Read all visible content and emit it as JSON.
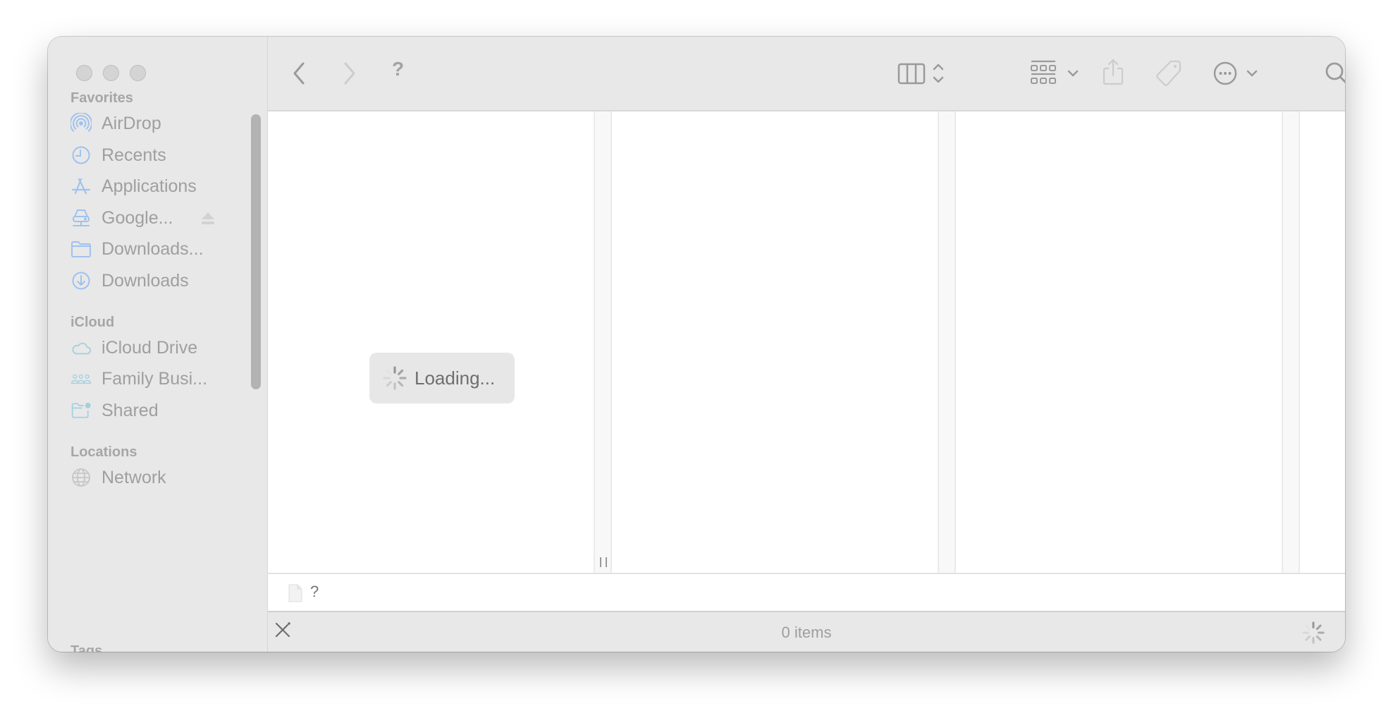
{
  "window": {
    "traffic_lights": [
      "close",
      "minimize",
      "zoom"
    ]
  },
  "sidebar": {
    "sections": [
      {
        "title": "Favorites",
        "items": [
          {
            "label": "AirDrop",
            "icon": "airdrop-icon"
          },
          {
            "label": "Recents",
            "icon": "clock-icon"
          },
          {
            "label": "Applications",
            "icon": "applications-icon"
          },
          {
            "label": "Google...",
            "icon": "network-drive-icon",
            "eject": true
          },
          {
            "label": "Downloads...",
            "icon": "folder-icon"
          },
          {
            "label": "Downloads",
            "icon": "download-icon"
          }
        ]
      },
      {
        "title": "iCloud",
        "items": [
          {
            "label": "iCloud Drive",
            "icon": "cloud-icon"
          },
          {
            "label": "Family Busi...",
            "icon": "people-icon"
          },
          {
            "label": "Shared",
            "icon": "shared-folder-icon"
          }
        ]
      },
      {
        "title": "Locations",
        "items": [
          {
            "label": "Network",
            "icon": "globe-icon"
          }
        ]
      },
      {
        "title": "Tags",
        "items": []
      }
    ]
  },
  "toolbar": {
    "title": "?",
    "back_label": "Back",
    "forward_label": "Forward",
    "view_mode": "columns",
    "group_label": "Group",
    "share_label": "Share",
    "tags_label": "Tags",
    "more_label": "More",
    "search_label": "Search"
  },
  "browser": {
    "loading_text": "Loading..."
  },
  "pathbar": {
    "path": "?"
  },
  "statusbar": {
    "item_count": "0 items"
  },
  "colors": {
    "sidebar_icon_blue": "#9fc2ee",
    "sidebar_icon_teal": "#a4d0dd",
    "chrome_gray": "#e8e8e8",
    "text_gray": "#9f9f9f"
  }
}
